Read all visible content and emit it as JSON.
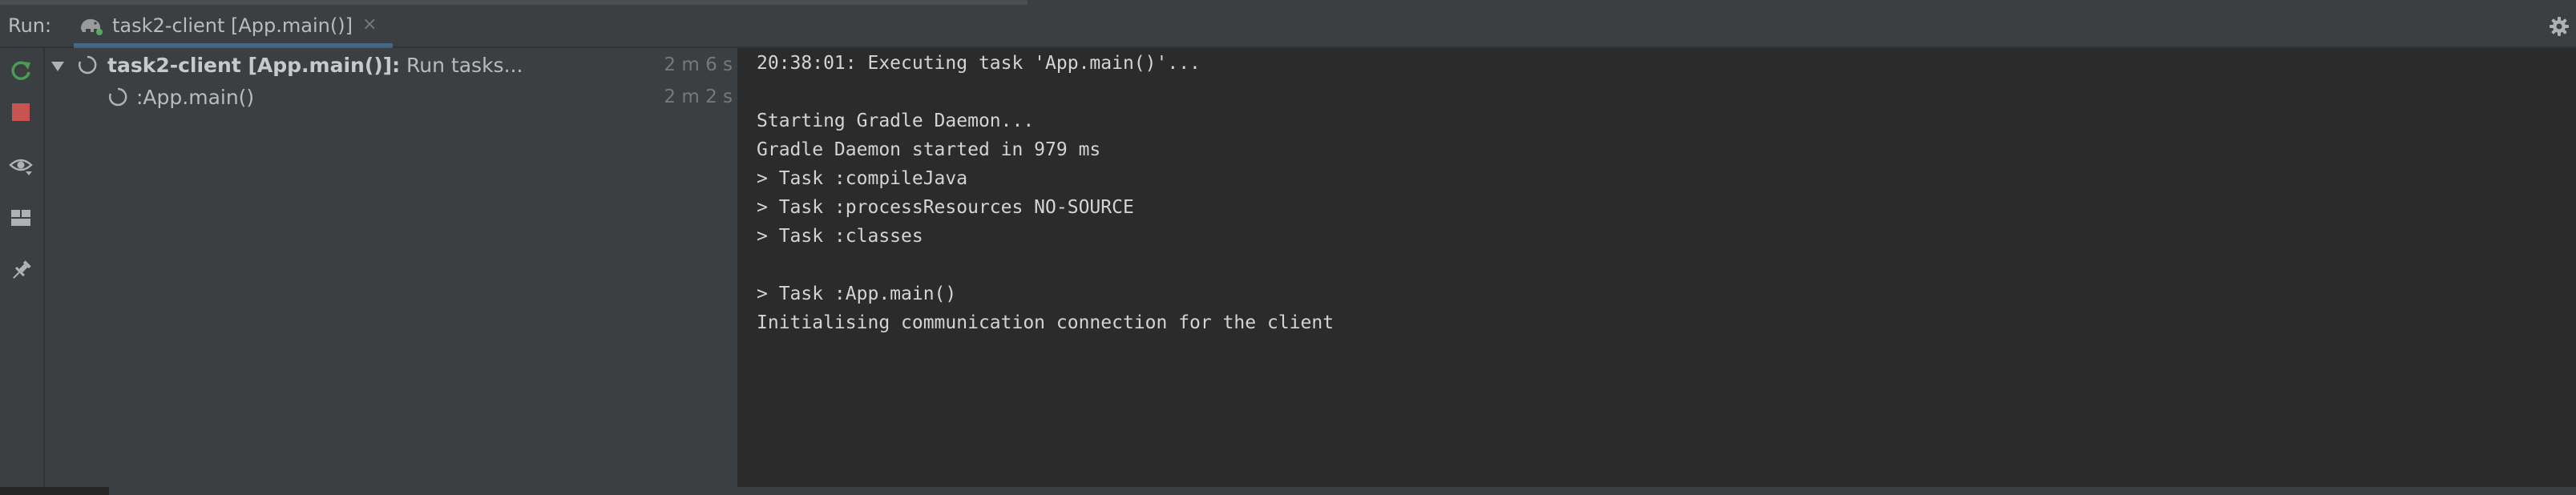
{
  "header": {
    "run_label": "Run:",
    "tab_title": "task2-client [App.main()]",
    "tab_close": "×"
  },
  "icons": {
    "tab": "gradle-elephant-icon",
    "rerun": "rerun-icon",
    "stop": "stop-icon",
    "view": "eye-icon",
    "layout": "layout-icon",
    "pin": "pin-icon",
    "settings": "gear-icon"
  },
  "tree": {
    "root": {
      "name_bold": "task2-client [App.main()]:",
      "name_rest": " Run tasks...",
      "time": "2 m 6 s"
    },
    "child": {
      "name": ":App.main()",
      "time": "2 m 2 s"
    }
  },
  "console": {
    "lines": [
      "20:38:01: Executing task 'App.main()'...",
      "",
      "Starting Gradle Daemon...",
      "Gradle Daemon started in 979 ms",
      "> Task :compileJava",
      "> Task :processResources NO-SOURCE",
      "> Task :classes",
      "",
      "> Task :App.main()",
      "Initialising communication connection for the client"
    ]
  },
  "colors": {
    "rerun_green": "#499c54",
    "stop_red": "#c75450",
    "tab_accent": "#4a88c7",
    "background": "#2b2b2b",
    "panel": "#3c3f41"
  }
}
